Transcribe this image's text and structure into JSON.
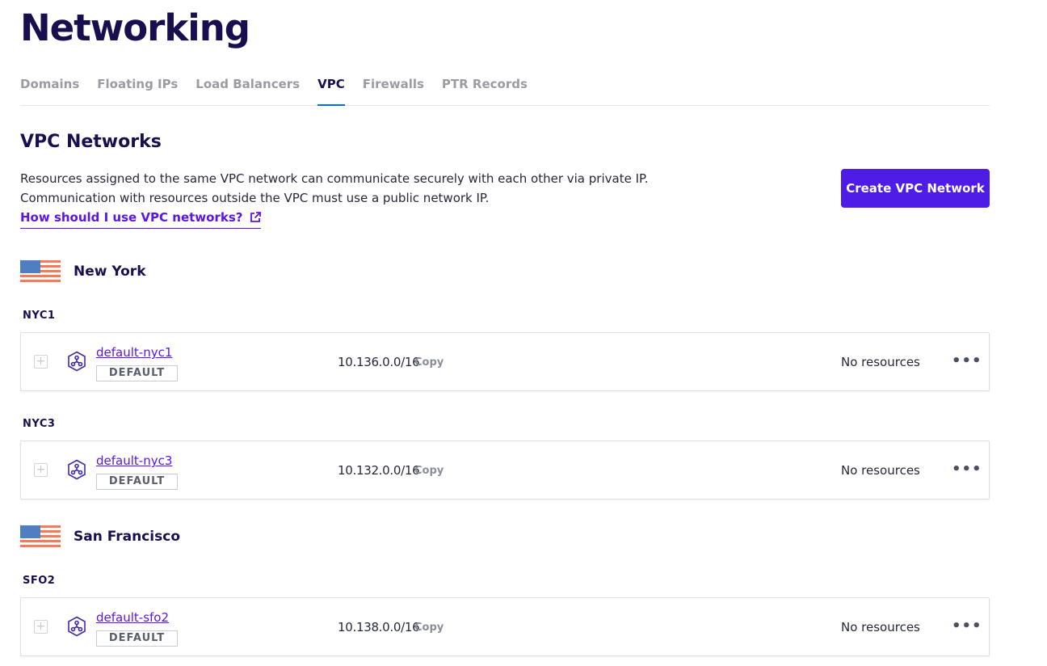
{
  "page": {
    "title": "Networking"
  },
  "tabs": [
    {
      "label": "Domains",
      "active": false
    },
    {
      "label": "Floating IPs",
      "active": false
    },
    {
      "label": "Load Balancers",
      "active": false
    },
    {
      "label": "VPC",
      "active": true
    },
    {
      "label": "Firewalls",
      "active": false
    },
    {
      "label": "PTR Records",
      "active": false
    }
  ],
  "section": {
    "title": "VPC Networks",
    "description_line1": "Resources assigned to the same VPC network can communicate securely with each other via private IP.",
    "description_line2": "Communication with resources outside the VPC must use a public network IP.",
    "help_link": "How should I use VPC networks?",
    "create_button": "Create VPC Network"
  },
  "regions": [
    {
      "name": "New York",
      "datacenters": [
        {
          "label": "NYC1",
          "vpc": {
            "name": "default-nyc1",
            "badge": "DEFAULT",
            "ip_range": "10.136.0.0/16",
            "copy": "Copy",
            "resources": "No resources",
            "more": "•••"
          }
        },
        {
          "label": "NYC3",
          "vpc": {
            "name": "default-nyc3",
            "badge": "DEFAULT",
            "ip_range": "10.132.0.0/16",
            "copy": "Copy",
            "resources": "No resources",
            "more": "•••"
          }
        }
      ]
    },
    {
      "name": "San Francisco",
      "datacenters": [
        {
          "label": "SFO2",
          "vpc": {
            "name": "default-sfo2",
            "badge": "DEFAULT",
            "ip_range": "10.138.0.0/16",
            "copy": "Copy",
            "resources": "No resources",
            "more": "•••"
          }
        }
      ]
    }
  ],
  "colors": {
    "accent": "#4f1be6",
    "link": "#5b15e8",
    "heading": "#1a0f4e",
    "flag_blue": "#4f7fc0",
    "flag_stripe": "#f27c5a"
  }
}
